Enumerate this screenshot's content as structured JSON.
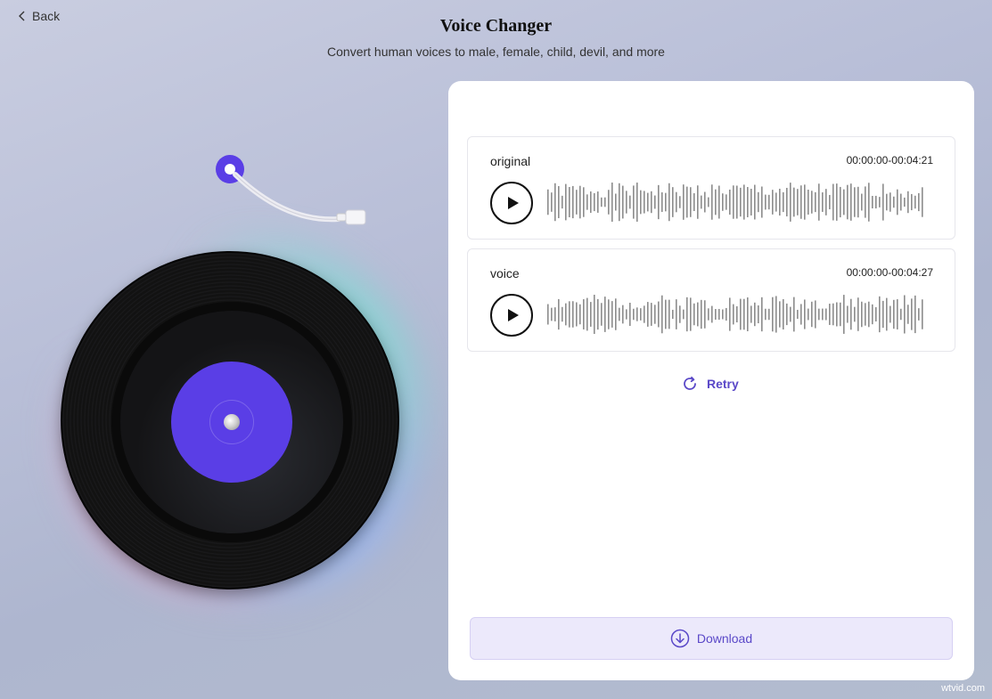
{
  "header": {
    "back_label": "Back",
    "title": "Voice Changer",
    "subtitle": "Convert human voices to male, female, child, devil, and more"
  },
  "tracks": [
    {
      "name": "original",
      "time": "00:00:00-00:04:21"
    },
    {
      "name": "voice",
      "time": "00:00:00-00:04:27"
    }
  ],
  "actions": {
    "retry_label": "Retry",
    "download_label": "Download"
  },
  "watermark": "wtvid.com",
  "colors": {
    "accent": "#5a3ee6",
    "accent_text": "#5a48c8",
    "waveform": "#8c8c8c"
  },
  "icons": {
    "back": "chevron-left-icon",
    "play": "play-icon",
    "retry": "refresh-icon",
    "download": "download-icon"
  }
}
